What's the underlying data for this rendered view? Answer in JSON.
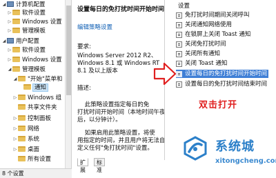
{
  "tree": {
    "items": [
      {
        "label": "计算机配置",
        "twist": "◢",
        "icon": "computer-icon"
      },
      {
        "label": "软件设置",
        "twist": "▷",
        "icon": "folder-icon"
      },
      {
        "label": "Windows 设置",
        "twist": "▷",
        "icon": "folder-icon"
      },
      {
        "label": "管理模板",
        "twist": "▷",
        "icon": "folder-icon"
      },
      {
        "label": "用户配置",
        "twist": "◢",
        "icon": "computer-icon"
      },
      {
        "label": "软件设置",
        "twist": "▷",
        "icon": "folder-icon"
      },
      {
        "label": "Windows 设置",
        "twist": "▷",
        "icon": "folder-icon"
      },
      {
        "label": "管理模板",
        "twist": "◢",
        "icon": "folder-icon"
      },
      {
        "label": "\"开始\"菜单和",
        "twist": "◢",
        "icon": "folder-icon"
      },
      {
        "label": "通知",
        "twist": "",
        "icon": "folder-icon",
        "selected": true
      },
      {
        "label": "Windows 组",
        "twist": "▷",
        "icon": "folder-icon"
      },
      {
        "label": "共享文件夹",
        "twist": "",
        "icon": "folder-icon"
      },
      {
        "label": "控制面板",
        "twist": "▷",
        "icon": "folder-icon"
      },
      {
        "label": "网络",
        "twist": "▷",
        "icon": "folder-icon"
      },
      {
        "label": "系统",
        "twist": "▷",
        "icon": "folder-icon"
      },
      {
        "label": "桌面",
        "twist": "▷",
        "icon": "folder-icon"
      },
      {
        "label": "所有设置",
        "twist": "",
        "icon": "folder-icon"
      }
    ]
  },
  "description": {
    "title": "设置每日的免打扰时间开始时间",
    "edit_link_text": "编辑策略设置",
    "requirements_label": "要求:",
    "requirements_text": "Windows Server 2012 R2、\nWindows 8.1 或 Windows RT\n8.1 及以上版本",
    "description_label": "描述:",
    "body_1": "    此策略设置指定每日的免\n打扰时间开始时间（本地时间午夜\n后，以分钟计）。",
    "body_2": "    如果启用此策略设置，将使\n用指定的时间，并且用户将无法自\n定义任何\"免打扰时间\"设置。"
  },
  "tabs": {
    "extended": "扩展",
    "standard": "标准"
  },
  "settings": {
    "header": "设置",
    "items": [
      {
        "label": "免打扰时间期间关闭呼叫",
        "selected": false
      },
      {
        "label": "关闭通知网络使用",
        "selected": false
      },
      {
        "label": "在锁屏上关闭 Toast 通知",
        "selected": false
      },
      {
        "label": "关闭免打扰时间",
        "selected": false
      },
      {
        "label": "关闭所有通知",
        "selected": false
      },
      {
        "label": "关闭 Toast 通知",
        "selected": false
      },
      {
        "label": "设置每日的免打扰时间开始时间",
        "selected": true
      },
      {
        "label": "设置每日的免打扰时间结束时间",
        "selected": false
      }
    ]
  },
  "annotation": {
    "text": "双击打开",
    "color": "#e02020"
  },
  "watermark": {
    "brand": "系统城",
    "url": "xitongcheng.com",
    "color": "#2c80c9"
  },
  "status_bar": {
    "text": "8 个设置"
  }
}
